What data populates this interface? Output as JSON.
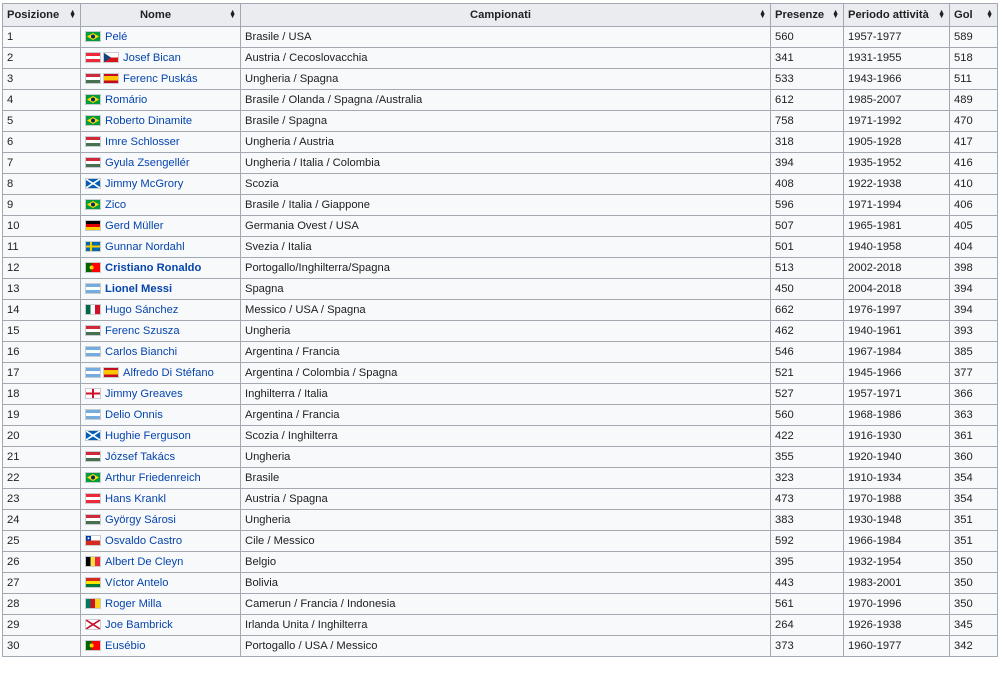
{
  "table": {
    "headers": [
      "Posizione",
      "Nome",
      "Campionati",
      "Presenze",
      "Periodo attività",
      "Gol"
    ],
    "rows": [
      {
        "pos": "1",
        "flags": [
          "brazil"
        ],
        "name": "Pelé",
        "bold": false,
        "leagues": "Brasile / USA",
        "apps": "560",
        "period": "1957-1977",
        "goals": "589"
      },
      {
        "pos": "2",
        "flags": [
          "austria",
          "czech"
        ],
        "name": "Josef Bican",
        "bold": false,
        "leagues": "Austria / Cecoslovacchia",
        "apps": "341",
        "period": "1931-1955",
        "goals": "518"
      },
      {
        "pos": "3",
        "flags": [
          "hungary",
          "spain"
        ],
        "name": "Ferenc Puskás",
        "bold": false,
        "leagues": "Ungheria / Spagna",
        "apps": "533",
        "period": "1943-1966",
        "goals": "511"
      },
      {
        "pos": "4",
        "flags": [
          "brazil"
        ],
        "name": "Romário",
        "bold": false,
        "leagues": "Brasile / Olanda / Spagna /Australia",
        "apps": "612",
        "period": "1985-2007",
        "goals": "489"
      },
      {
        "pos": "5",
        "flags": [
          "brazil"
        ],
        "name": "Roberto Dinamite",
        "bold": false,
        "leagues": "Brasile / Spagna",
        "apps": "758",
        "period": "1971-1992",
        "goals": "470"
      },
      {
        "pos": "6",
        "flags": [
          "hungary"
        ],
        "name": "Imre Schlosser",
        "bold": false,
        "leagues": "Ungheria / Austria",
        "apps": "318",
        "period": "1905-1928",
        "goals": "417"
      },
      {
        "pos": "7",
        "flags": [
          "hungary"
        ],
        "name": "Gyula Zsengellér",
        "bold": false,
        "leagues": "Ungheria / Italia / Colombia",
        "apps": "394",
        "period": "1935-1952",
        "goals": "416"
      },
      {
        "pos": "8",
        "flags": [
          "scotland"
        ],
        "name": "Jimmy McGrory",
        "bold": false,
        "leagues": "Scozia",
        "apps": "408",
        "period": "1922-1938",
        "goals": "410"
      },
      {
        "pos": "9",
        "flags": [
          "brazil"
        ],
        "name": "Zico",
        "bold": false,
        "leagues": "Brasile / Italia / Giappone",
        "apps": "596",
        "period": "1971-1994",
        "goals": "406"
      },
      {
        "pos": "10",
        "flags": [
          "germany"
        ],
        "name": "Gerd Müller",
        "bold": false,
        "leagues": "Germania Ovest / USA",
        "apps": "507",
        "period": "1965-1981",
        "goals": "405"
      },
      {
        "pos": "11",
        "flags": [
          "sweden"
        ],
        "name": "Gunnar Nordahl",
        "bold": false,
        "leagues": "Svezia / Italia",
        "apps": "501",
        "period": "1940-1958",
        "goals": "404"
      },
      {
        "pos": "12",
        "flags": [
          "portugal"
        ],
        "name": "Cristiano Ronaldo",
        "bold": true,
        "leagues": "Portogallo/Inghilterra/Spagna",
        "apps": "513",
        "period": "2002-2018",
        "goals": "398"
      },
      {
        "pos": "13",
        "flags": [
          "argentina"
        ],
        "name": "Lionel Messi",
        "bold": true,
        "leagues": "Spagna",
        "apps": "450",
        "period": "2004-2018",
        "goals": "394"
      },
      {
        "pos": "14",
        "flags": [
          "mexico"
        ],
        "name": "Hugo Sánchez",
        "bold": false,
        "leagues": "Messico / USA / Spagna",
        "apps": "662",
        "period": "1976-1997",
        "goals": "394"
      },
      {
        "pos": "15",
        "flags": [
          "hungary"
        ],
        "name": "Ferenc Szusza",
        "bold": false,
        "leagues": "Ungheria",
        "apps": "462",
        "period": "1940-1961",
        "goals": "393"
      },
      {
        "pos": "16",
        "flags": [
          "argentina"
        ],
        "name": "Carlos Bianchi",
        "bold": false,
        "leagues": "Argentina / Francia",
        "apps": "546",
        "period": "1967-1984",
        "goals": "385"
      },
      {
        "pos": "17",
        "flags": [
          "argentina",
          "spain"
        ],
        "name": "Alfredo Di Stéfano",
        "bold": false,
        "leagues": "Argentina / Colombia / Spagna",
        "apps": "521",
        "period": "1945-1966",
        "goals": "377"
      },
      {
        "pos": "18",
        "flags": [
          "england"
        ],
        "name": "Jimmy Greaves",
        "bold": false,
        "leagues": "Inghilterra / Italia",
        "apps": "527",
        "period": "1957-1971",
        "goals": "366"
      },
      {
        "pos": "19",
        "flags": [
          "argentina"
        ],
        "name": "Delio Onnis",
        "bold": false,
        "leagues": "Argentina / Francia",
        "apps": "560",
        "period": "1968-1986",
        "goals": "363"
      },
      {
        "pos": "20",
        "flags": [
          "scotland"
        ],
        "name": "Hughie Ferguson",
        "bold": false,
        "leagues": "Scozia / Inghilterra",
        "apps": "422",
        "period": "1916-1930",
        "goals": "361"
      },
      {
        "pos": "21",
        "flags": [
          "hungary"
        ],
        "name": "József Takács",
        "bold": false,
        "leagues": "Ungheria",
        "apps": "355",
        "period": "1920-1940",
        "goals": "360"
      },
      {
        "pos": "22",
        "flags": [
          "brazil"
        ],
        "name": "Arthur Friedenreich",
        "bold": false,
        "leagues": "Brasile",
        "apps": "323",
        "period": "1910-1934",
        "goals": "354"
      },
      {
        "pos": "23",
        "flags": [
          "austria"
        ],
        "name": "Hans Krankl",
        "bold": false,
        "leagues": "Austria / Spagna",
        "apps": "473",
        "period": "1970-1988",
        "goals": "354"
      },
      {
        "pos": "24",
        "flags": [
          "hungary"
        ],
        "name": "György Sárosi",
        "bold": false,
        "leagues": "Ungheria",
        "apps": "383",
        "period": "1930-1948",
        "goals": "351"
      },
      {
        "pos": "25",
        "flags": [
          "chile"
        ],
        "name": "Osvaldo Castro",
        "bold": false,
        "leagues": "Cile / Messico",
        "apps": "592",
        "period": "1966-1984",
        "goals": "351"
      },
      {
        "pos": "26",
        "flags": [
          "belgium"
        ],
        "name": "Albert De Cleyn",
        "bold": false,
        "leagues": "Belgio",
        "apps": "395",
        "period": "1932-1954",
        "goals": "350"
      },
      {
        "pos": "27",
        "flags": [
          "bolivia"
        ],
        "name": "Víctor Antelo",
        "bold": false,
        "leagues": "Bolivia",
        "apps": "443",
        "period": "1983-2001",
        "goals": "350"
      },
      {
        "pos": "28",
        "flags": [
          "cameroon"
        ],
        "name": "Roger Milla",
        "bold": false,
        "leagues": "Camerun / Francia / Indonesia",
        "apps": "561",
        "period": "1970-1996",
        "goals": "350"
      },
      {
        "pos": "29",
        "flags": [
          "northernireland"
        ],
        "name": "Joe Bambrick",
        "bold": false,
        "leagues": "Irlanda Unita / Inghilterra",
        "apps": "264",
        "period": "1926-1938",
        "goals": "345"
      },
      {
        "pos": "30",
        "flags": [
          "portugal"
        ],
        "name": "Eusébio",
        "bold": false,
        "leagues": "Portogallo / USA / Messico",
        "apps": "373",
        "period": "1960-1977",
        "goals": "342"
      }
    ]
  },
  "colors": {
    "link": "#0645ad",
    "header_bg": "#eaecf0",
    "cell_bg": "#f8f9fa",
    "border": "#a2a9b1"
  }
}
